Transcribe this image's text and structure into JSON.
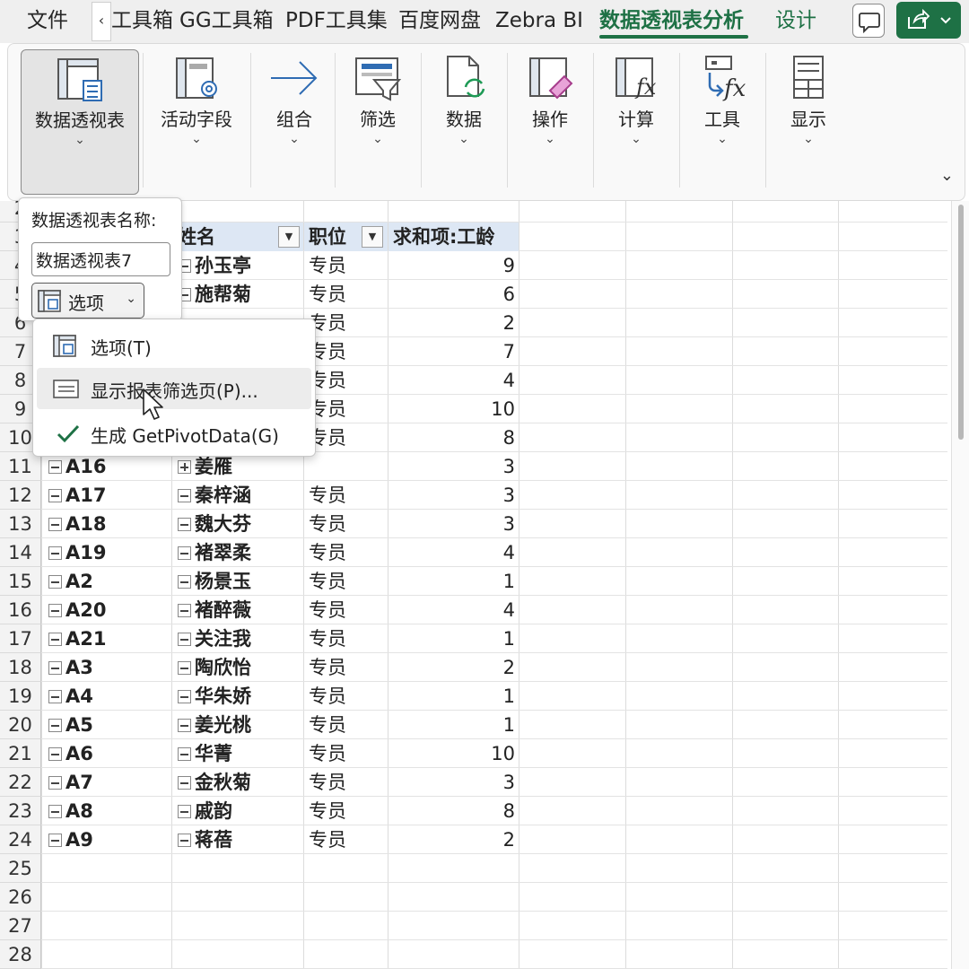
{
  "tabs": [
    {
      "label": "文件",
      "active": false
    },
    {
      "label": "工具箱",
      "active": false
    },
    {
      "label": "GG工具箱",
      "active": false
    },
    {
      "label": "PDF工具集",
      "active": false
    },
    {
      "label": "百度网盘",
      "active": false
    },
    {
      "label": "Zebra BI",
      "active": false
    },
    {
      "label": "数据透视表分析",
      "active": true
    },
    {
      "label": "设计",
      "active": false
    }
  ],
  "accent_color": "#1e7145",
  "ribbon": {
    "groups": [
      {
        "label": "数据透视表",
        "icon": "pivottable-icon"
      },
      {
        "label": "活动字段",
        "icon": "active-field-icon"
      },
      {
        "label": "组合",
        "icon": "group-arrow-icon"
      },
      {
        "label": "筛选",
        "icon": "filter-icon"
      },
      {
        "label": "数据",
        "icon": "data-refresh-icon"
      },
      {
        "label": "操作",
        "icon": "actions-icon"
      },
      {
        "label": "计算",
        "icon": "calculations-icon"
      },
      {
        "label": "工具",
        "icon": "tools-icon"
      },
      {
        "label": "显示",
        "icon": "show-icon"
      }
    ]
  },
  "panel": {
    "name_label": "数据透视表名称:",
    "name_value": "数据透视表7",
    "options_label": "选项"
  },
  "submenu": {
    "items": [
      {
        "label": "选项(T)",
        "icon": "options-icon"
      },
      {
        "label": "显示报表筛选页(P)...",
        "icon": "report-filter-pages-icon"
      },
      {
        "label": "生成 GetPivotData(G)",
        "icon": "check-icon",
        "checked": true
      }
    ]
  },
  "grid": {
    "row_numbers": [
      "2",
      "3",
      "4",
      "5",
      "6",
      "7",
      "8",
      "9",
      "10",
      "11",
      "12",
      "13",
      "14",
      "15",
      "16",
      "17",
      "18",
      "19",
      "20",
      "21",
      "22",
      "23",
      "24",
      "25",
      "26",
      "27",
      "28"
    ],
    "headers": {
      "name": "姓名",
      "position": "职位",
      "sum": "求和项:工龄"
    },
    "rows": [
      {
        "id": "",
        "name": "孙玉亭",
        "position": "专员",
        "value": "9"
      },
      {
        "id": "",
        "name": "施帮菊",
        "position": "专员",
        "value": "6"
      },
      {
        "id": "",
        "name": "",
        "position": "专员",
        "value": "2"
      },
      {
        "id": "",
        "name": "",
        "position": "专员",
        "value": "7"
      },
      {
        "id": "",
        "name": "",
        "position": "专员",
        "value": "4"
      },
      {
        "id": "",
        "name": "",
        "position": "专员",
        "value": "10"
      },
      {
        "id": "",
        "name": "",
        "position": "专员",
        "value": "8"
      },
      {
        "id": "A16",
        "name": "姜雁",
        "position": "",
        "value": "3",
        "collapsed": true
      },
      {
        "id": "A17",
        "name": "秦梓涵",
        "position": "专员",
        "value": "3"
      },
      {
        "id": "A18",
        "name": "魏大芬",
        "position": "专员",
        "value": "3"
      },
      {
        "id": "A19",
        "name": "褚翠柔",
        "position": "专员",
        "value": "4"
      },
      {
        "id": "A2",
        "name": "杨景玉",
        "position": "专员",
        "value": "1"
      },
      {
        "id": "A20",
        "name": "褚醉薇",
        "position": "专员",
        "value": "4"
      },
      {
        "id": "A21",
        "name": "关注我",
        "position": "专员",
        "value": "1"
      },
      {
        "id": "A3",
        "name": "陶欣怡",
        "position": "专员",
        "value": "2"
      },
      {
        "id": "A4",
        "name": "华朱娇",
        "position": "专员",
        "value": "1"
      },
      {
        "id": "A5",
        "name": "姜光桃",
        "position": "专员",
        "value": "1"
      },
      {
        "id": "A6",
        "name": "华菁",
        "position": "专员",
        "value": "10"
      },
      {
        "id": "A7",
        "name": "金秋菊",
        "position": "专员",
        "value": "3"
      },
      {
        "id": "A8",
        "name": "戚韵",
        "position": "专员",
        "value": "8"
      },
      {
        "id": "A9",
        "name": "蒋蓓",
        "position": "专员",
        "value": "2"
      }
    ]
  }
}
